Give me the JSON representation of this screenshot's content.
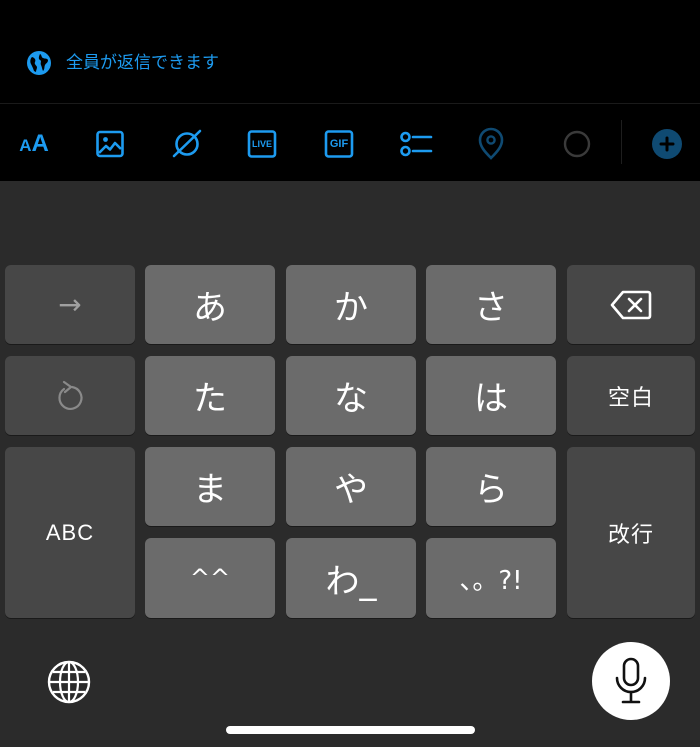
{
  "reply": {
    "setting_label": "全員が返信できます",
    "accent": "#1d9bf0"
  },
  "toolbar": {
    "items": [
      {
        "name": "text-size-button",
        "icon": "aa-text-icon",
        "label": "AA"
      },
      {
        "name": "image-button",
        "icon": "image-icon"
      },
      {
        "name": "spaces-button",
        "icon": "orbit-icon"
      },
      {
        "name": "live-button",
        "icon": "live-icon",
        "label": "LIVE"
      },
      {
        "name": "gif-button",
        "icon": "gif-icon",
        "label": "GIF"
      },
      {
        "name": "poll-button",
        "icon": "poll-list-icon"
      },
      {
        "name": "location-button",
        "icon": "location-pin-icon",
        "state": "disabled"
      },
      {
        "name": "character-count-ring",
        "icon": "progress-ring-icon"
      },
      {
        "name": "add-post-button",
        "icon": "plus-circle-icon",
        "state": "disabled"
      }
    ]
  },
  "keyboard": {
    "row1": {
      "left": "→",
      "keys": [
        "あ",
        "か",
        "さ"
      ],
      "right_icon": "backspace-icon"
    },
    "row2": {
      "left_icon": "undo-icon",
      "keys": [
        "た",
        "な",
        "は"
      ],
      "right": "空白"
    },
    "row3": {
      "keys": [
        "ま",
        "や",
        "ら"
      ]
    },
    "row4": {
      "keys": [
        "^^",
        "わ_",
        "、。?!"
      ]
    },
    "abc": "ABC",
    "return": "改行",
    "bottom": {
      "globe_icon": "globe-icon",
      "mic_icon": "microphone-icon"
    }
  }
}
